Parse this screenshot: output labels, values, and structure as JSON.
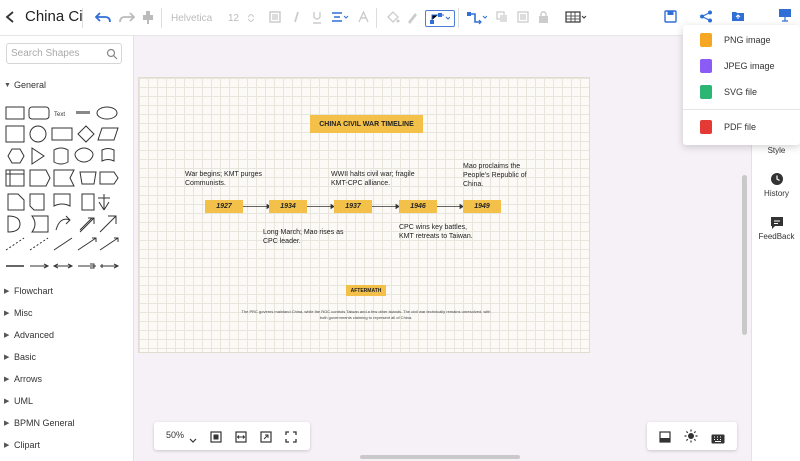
{
  "app": {
    "title": "China Ci",
    "font_name": "Helvetica",
    "font_size": "12"
  },
  "sidebar": {
    "search_placeholder": "Search Shapes",
    "general_label": "General",
    "general_text_shape": "Text",
    "sections": [
      "Flowchart",
      "Misc",
      "Advanced",
      "Basic",
      "Arrows",
      "UML",
      "BPMN General",
      "Clipart"
    ]
  },
  "diagram": {
    "title": "CHINA CIVIL WAR TIMELINE",
    "years": [
      "1927",
      "1934",
      "1937",
      "1946",
      "1949"
    ],
    "notes_above": [
      "War begins; KMT purges Communists.",
      "WWII halts civil war; fragile KMT-CPC alliance.",
      "Mao proclaims the People's Republic of China."
    ],
    "notes_below": [
      "Long March; Mao rises as CPC leader.",
      "CPC wins key battles, KMT retreats to Taiwan."
    ],
    "aftermath_label": "AFTERMATH",
    "summary": "The PRC governs mainland China, while the ROC controls Taiwan and a few other islands. The civil war technically remains unresolved, with both governments claiming to represent all of China."
  },
  "zoom": {
    "level": "50%"
  },
  "right_panel": {
    "items": [
      "Style",
      "History",
      "FeedBack"
    ]
  },
  "export_menu": {
    "items": [
      {
        "label": "PNG image",
        "icon": "png-file-icon",
        "color": "#f5a623"
      },
      {
        "label": "JPEG image",
        "icon": "jpeg-file-icon",
        "color": "#8a5cf5"
      },
      {
        "label": "SVG file",
        "icon": "svg-file-icon",
        "color": "#2bb673"
      },
      {
        "label": "PDF file",
        "icon": "pdf-file-icon",
        "color": "#e53935"
      }
    ]
  },
  "colors": {
    "accent": "#2f6fd6",
    "timeline_box": "#f3c04a"
  }
}
